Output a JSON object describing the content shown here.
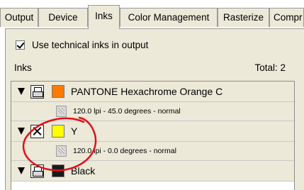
{
  "tabs": [
    {
      "label": "Output",
      "active": false
    },
    {
      "label": "Device",
      "active": false
    },
    {
      "label": "Inks",
      "active": true
    },
    {
      "label": "Color Management",
      "active": false
    },
    {
      "label": "Rasterize",
      "active": false
    },
    {
      "label": "Compr",
      "active": false
    }
  ],
  "options": {
    "use_technical_inks_label": "Use technical inks in output",
    "use_technical_inks_checked": true
  },
  "inks_section": {
    "label": "Inks",
    "total": "Total: 2"
  },
  "ink_list": [
    {
      "name": "PANTONE Hexachrome Orange C",
      "color": "#ff7a00",
      "printing": true,
      "expanded": true,
      "screen": "120.0 lpi - 45.0 degrees - normal"
    },
    {
      "name": "Y",
      "color": "#ffff00",
      "printing": false,
      "expanded": true,
      "screen": "120.0 lpi - 0.0 degrees - normal"
    },
    {
      "name": "Black",
      "color": "#1a1a1a",
      "printing": true,
      "expanded": true
    }
  ],
  "annotation": {
    "shape": "circle",
    "color": "#e0101a"
  }
}
